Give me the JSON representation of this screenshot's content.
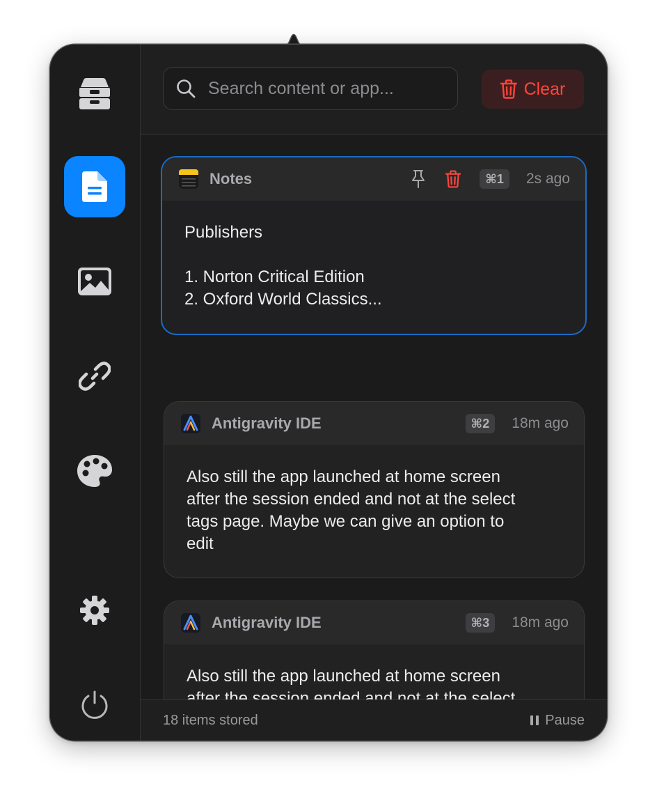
{
  "search": {
    "placeholder": "Search content or app...",
    "value": ""
  },
  "toolbar": {
    "clear_label": "Clear"
  },
  "sidebar": {
    "items": [
      {
        "icon": "archive-box-icon",
        "active": false
      },
      {
        "icon": "document-icon",
        "active": true
      },
      {
        "icon": "image-icon",
        "active": false
      },
      {
        "icon": "link-icon",
        "active": false
      },
      {
        "icon": "palette-icon",
        "active": false
      },
      {
        "icon": "gear-icon",
        "active": false
      },
      {
        "icon": "power-icon",
        "active": false
      }
    ]
  },
  "items": [
    {
      "app": "Notes",
      "shortcut": "⌘1",
      "time": "2s ago",
      "content": "Publishers\n\n1. Norton Critical Edition\n2. Oxford World Classics...",
      "selected": true
    },
    {
      "app": "Antigravity IDE",
      "shortcut": "⌘2",
      "time": "18m ago",
      "content": "Also still the app launched at home screen\nafter the session ended and not at the select\ntags page. Maybe we can give an option to\nedit",
      "selected": false
    },
    {
      "app": "Antigravity IDE",
      "shortcut": "⌘3",
      "time": "18m ago",
      "content": "Also still the app launched at home screen\nafter the session ended and not at the select\ntags page. Maybe we",
      "selected": false
    }
  ],
  "footer": {
    "count_label": "18 items stored",
    "pause_label": "Pause"
  },
  "colors": {
    "accent": "#0a84ff",
    "danger": "#ff453a",
    "selected_border": "#1a6bc4"
  }
}
